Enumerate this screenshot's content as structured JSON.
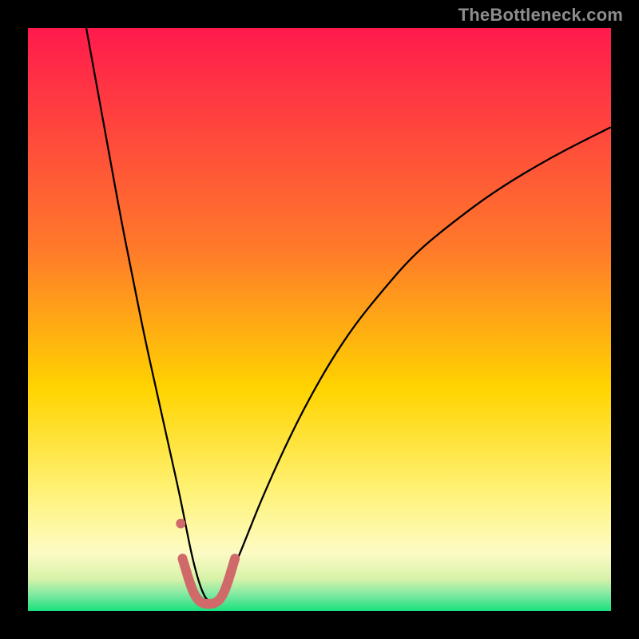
{
  "watermark": "TheBottleneck.com",
  "chart_data": {
    "type": "line",
    "title": "",
    "xlabel": "",
    "ylabel": "",
    "xlim": [
      0,
      100
    ],
    "ylim": [
      0,
      100
    ],
    "background_gradient": {
      "stops": [
        {
          "pos": 0.0,
          "color": "#ff1a4d"
        },
        {
          "pos": 0.38,
          "color": "#ff7a2a"
        },
        {
          "pos": 0.62,
          "color": "#ffd400"
        },
        {
          "pos": 0.8,
          "color": "#fff37a"
        },
        {
          "pos": 0.9,
          "color": "#fdfbc5"
        },
        {
          "pos": 0.945,
          "color": "#d7f2a8"
        },
        {
          "pos": 0.972,
          "color": "#7fe9a2"
        },
        {
          "pos": 1.0,
          "color": "#18e07e"
        }
      ]
    },
    "curve_optimum_x": 31,
    "series": [
      {
        "name": "bottleneck-curve",
        "color": "#000000",
        "stroke_width": 2.3,
        "x": [
          10,
          12,
          14,
          16,
          18,
          20,
          22,
          24,
          26,
          27,
          28,
          29,
          30,
          31,
          32,
          33,
          34,
          35,
          36,
          38,
          40,
          44,
          48,
          52,
          56,
          60,
          66,
          72,
          80,
          90,
          100
        ],
        "y": [
          100,
          89,
          78,
          67,
          57,
          47,
          38,
          29,
          20,
          15,
          10,
          6,
          3,
          1.5,
          1.5,
          3,
          5,
          7,
          9,
          14,
          19,
          28,
          36,
          43,
          49,
          54,
          61,
          66,
          72,
          78,
          83
        ]
      },
      {
        "name": "highlight-band",
        "color": "#d06a6a",
        "stroke_width": 12,
        "linecap": "round",
        "x": [
          26.5,
          28,
          29,
          30,
          31,
          32,
          33,
          34,
          35.5
        ],
        "y": [
          9,
          4,
          2,
          1.3,
          1.2,
          1.3,
          2,
          4,
          9
        ]
      },
      {
        "name": "highlight-dot-left",
        "type": "scatter",
        "color": "#d06a6a",
        "radius": 6,
        "x": [
          26.2
        ],
        "y": [
          15
        ]
      }
    ]
  }
}
